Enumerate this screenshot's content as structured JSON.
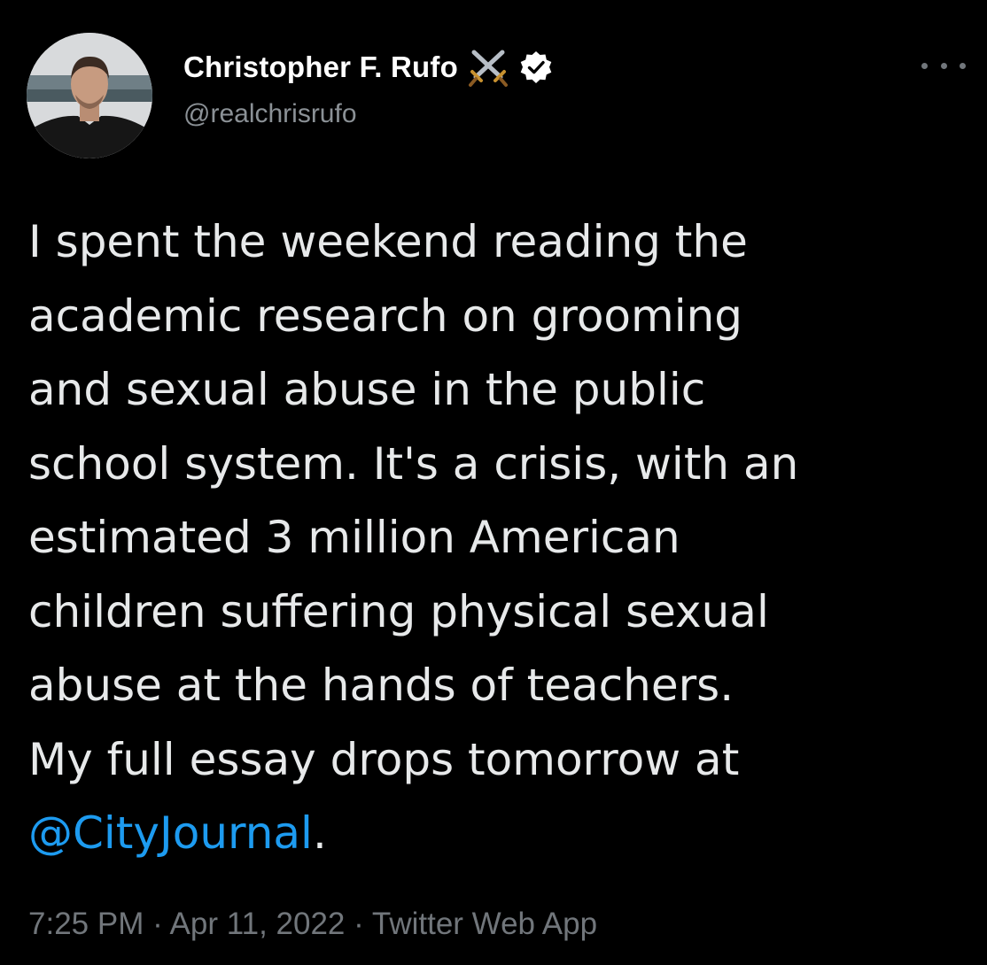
{
  "author": {
    "display_name": "Christopher F. Rufo",
    "handle": "@realchrisrufo",
    "badges": [
      "crossed-swords-icon",
      "verified-badge-icon"
    ],
    "more_menu_icon": "more-horizontal-icon"
  },
  "tweet": {
    "lines": [
      "I spent the weekend reading the",
      "academic research on grooming",
      "and sexual abuse in the public",
      "school system. It's a crisis, with an",
      "estimated 3 million American",
      "children suffering physical sexual",
      "abuse at the hands of teachers.",
      "My full essay drops tomorrow at"
    ],
    "mention": "@CityJournal",
    "mention_suffix": "."
  },
  "meta": {
    "time": "7:25 PM",
    "separator": " · ",
    "date": "Apr 11, 2022",
    "source": "Twitter Web App"
  },
  "colors": {
    "background": "#000000",
    "text": "#e7e9ea",
    "secondary": "#71767b",
    "link": "#1d9bf0"
  }
}
